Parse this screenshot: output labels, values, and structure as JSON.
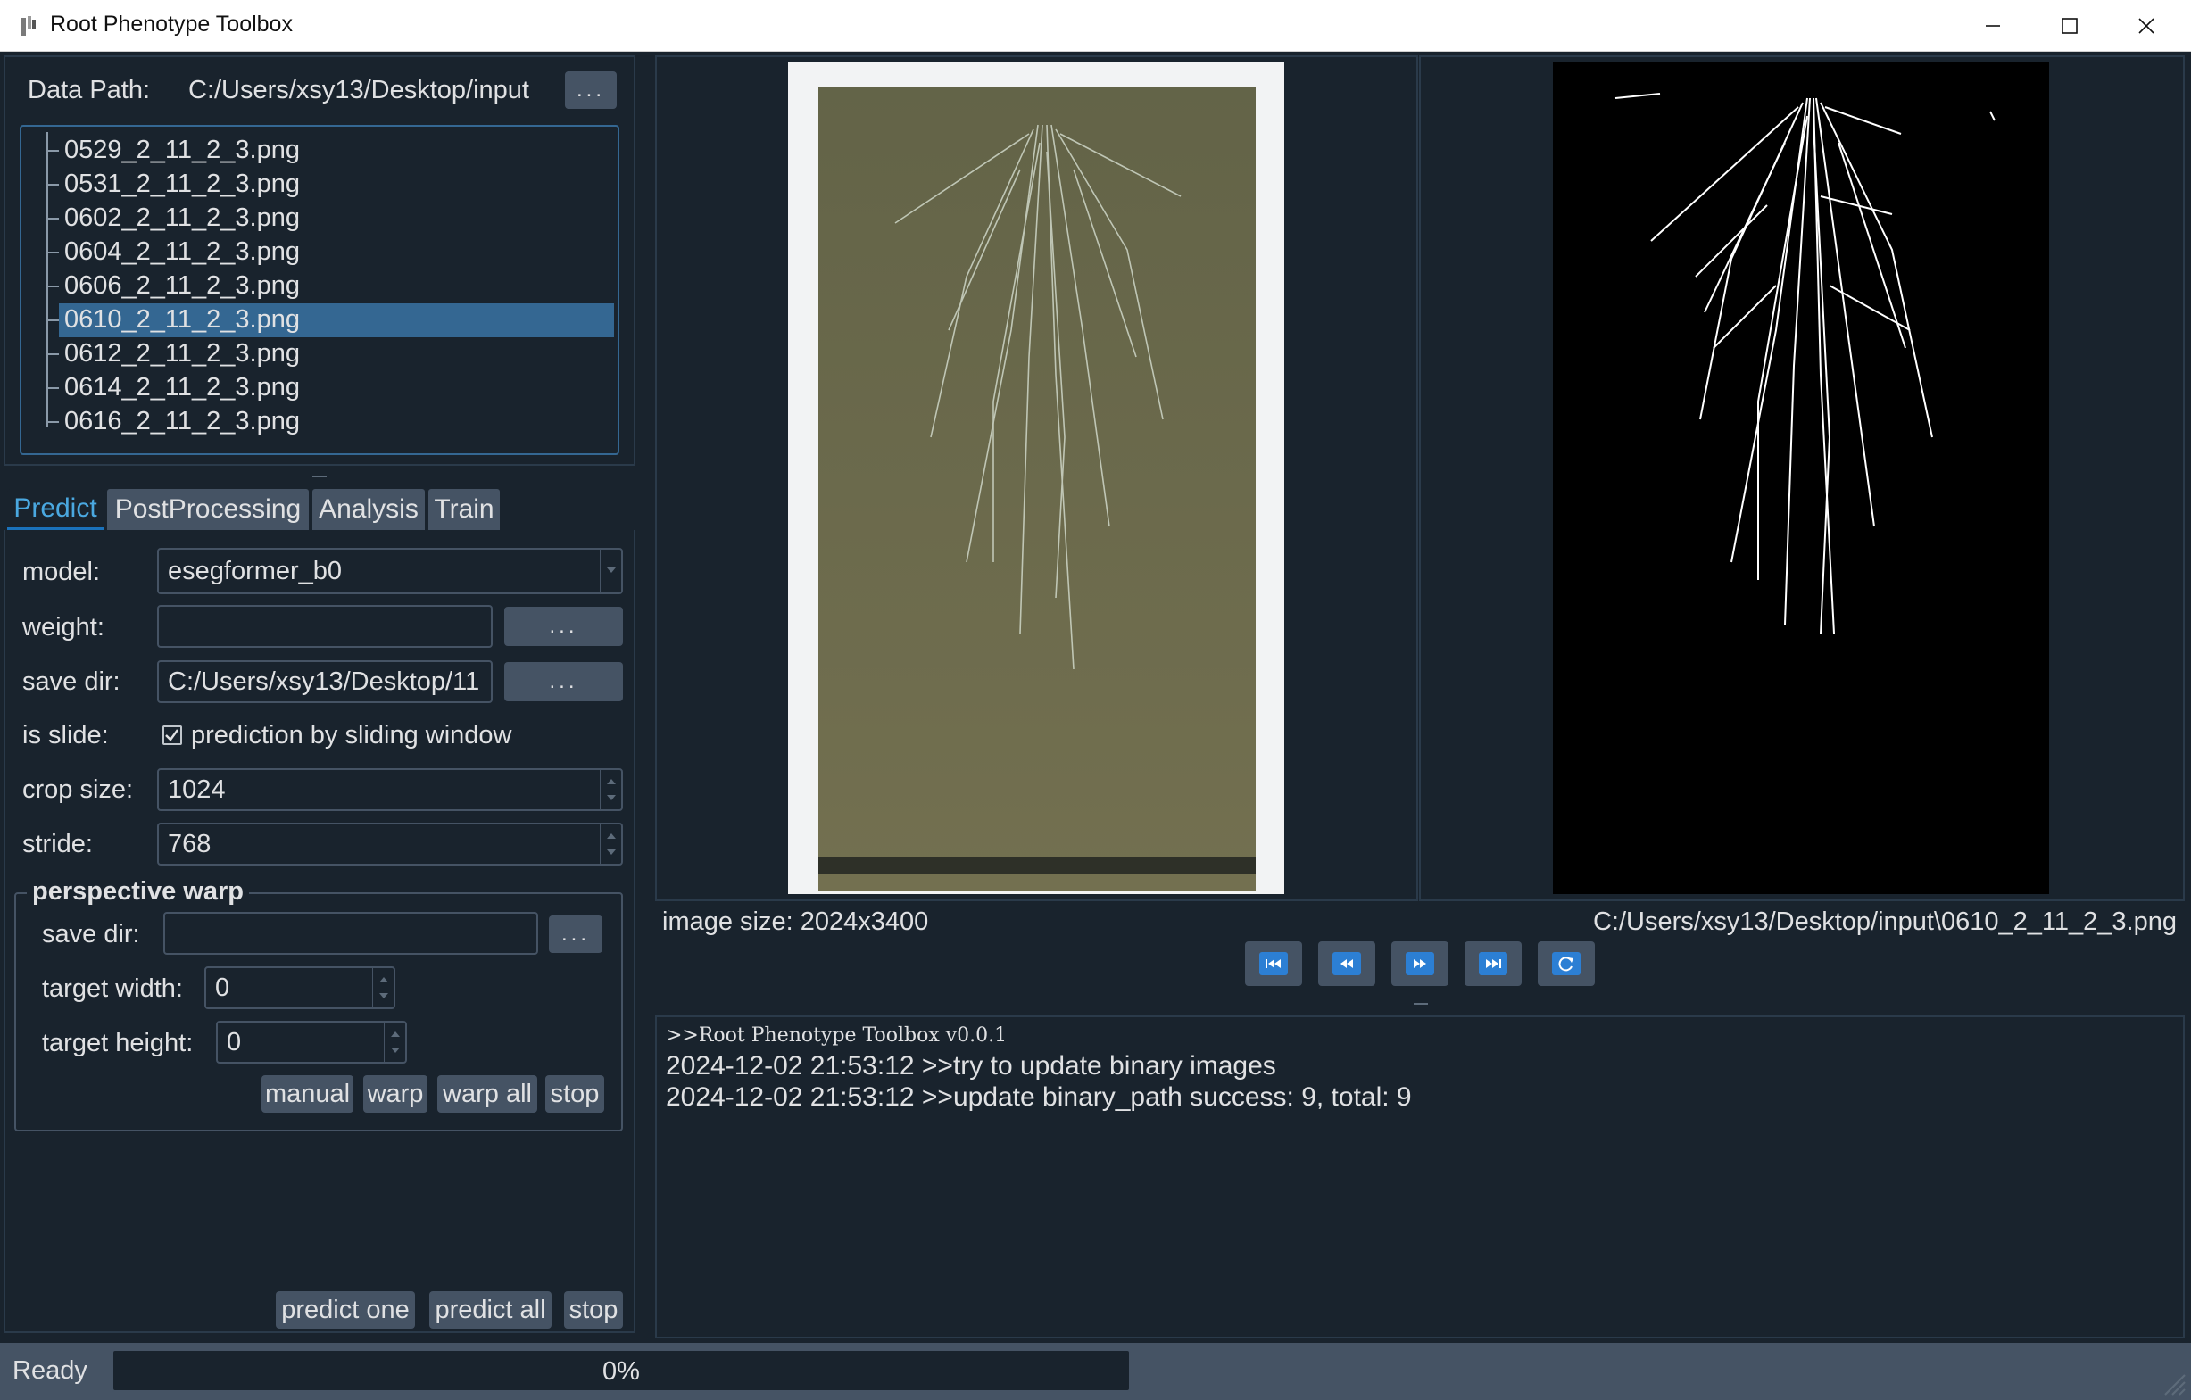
{
  "window": {
    "title": "Root Phenotype Toolbox",
    "icon": "app-icon",
    "controls": [
      "minimize-icon",
      "maximize-icon",
      "close-icon"
    ]
  },
  "data_path": {
    "label": "Data Path:",
    "value": "C:/Users/xsy13/Desktop/input",
    "browse_label": "..."
  },
  "files": [
    "0529_2_11_2_3.png",
    "0531_2_11_2_3.png",
    "0602_2_11_2_3.png",
    "0604_2_11_2_3.png",
    "0606_2_11_2_3.png",
    "0610_2_11_2_3.png",
    "0612_2_11_2_3.png",
    "0614_2_11_2_3.png",
    "0616_2_11_2_3.png"
  ],
  "selected_file_index": 5,
  "tabs": [
    {
      "label": "Predict",
      "active": true
    },
    {
      "label": "PostProcessing",
      "active": false
    },
    {
      "label": "Analysis",
      "active": false
    },
    {
      "label": "Train",
      "active": false
    }
  ],
  "predict": {
    "model_label": "model:",
    "model_value": "esegformer_b0",
    "weight_label": "weight:",
    "weight_value": "",
    "weight_browse": "...",
    "save_dir_label": "save dir:",
    "save_dir_value": "C:/Users/xsy13/Desktop/11",
    "save_dir_browse": "...",
    "is_slide_label": "is slide:",
    "is_slide_checked": true,
    "is_slide_text": "prediction by sliding window",
    "crop_size_label": "crop size:",
    "crop_size_value": "1024",
    "stride_label": "stride:",
    "stride_value": "768",
    "warp": {
      "title": "perspective warp",
      "save_dir_label": "save dir:",
      "save_dir_value": "",
      "save_dir_browse": "...",
      "target_width_label": "target width:",
      "target_width_value": "0",
      "target_height_label": "target height:",
      "target_height_value": "0",
      "buttons": {
        "manual": "manual",
        "warp": "warp",
        "warp_all": "warp all",
        "stop": "stop"
      }
    },
    "actions": {
      "predict_one": "predict one",
      "predict_all": "predict all",
      "stop": "stop"
    }
  },
  "viewer": {
    "image_size": "image size: 2024x3400",
    "image_path": "C:/Users/xsy13/Desktop/input\\0610_2_11_2_3.png",
    "nav_icons": [
      "first-icon",
      "previous-icon",
      "next-icon",
      "last-icon",
      "refresh-icon"
    ]
  },
  "log": [
    ">>Root Phenotype Toolbox v0.0.1",
    "2024-12-02 21:53:12 >>try to update binary images",
    "2024-12-02 21:53:12 >>update binary_path success: 9, total: 9"
  ],
  "status": {
    "text": "Ready",
    "progress_text": "0%",
    "progress": 0
  },
  "colors": {
    "background": "#19232d",
    "control": "#455364",
    "accent": "#346792",
    "tab_active_text": "#4aa8e0"
  }
}
